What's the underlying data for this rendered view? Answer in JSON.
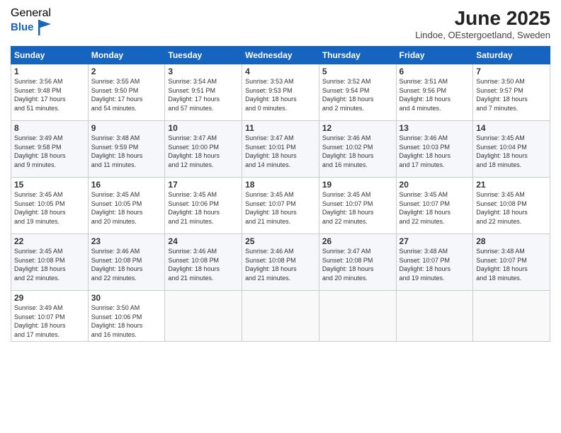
{
  "logo": {
    "general": "General",
    "blue": "Blue"
  },
  "title": "June 2025",
  "subtitle": "Lindoe, OEstergoetland, Sweden",
  "days_header": [
    "Sunday",
    "Monday",
    "Tuesday",
    "Wednesday",
    "Thursday",
    "Friday",
    "Saturday"
  ],
  "weeks": [
    [
      {
        "day": "1",
        "info": "Sunrise: 3:56 AM\nSunset: 9:48 PM\nDaylight: 17 hours\nand 51 minutes."
      },
      {
        "day": "2",
        "info": "Sunrise: 3:55 AM\nSunset: 9:50 PM\nDaylight: 17 hours\nand 54 minutes."
      },
      {
        "day": "3",
        "info": "Sunrise: 3:54 AM\nSunset: 9:51 PM\nDaylight: 17 hours\nand 57 minutes."
      },
      {
        "day": "4",
        "info": "Sunrise: 3:53 AM\nSunset: 9:53 PM\nDaylight: 18 hours\nand 0 minutes."
      },
      {
        "day": "5",
        "info": "Sunrise: 3:52 AM\nSunset: 9:54 PM\nDaylight: 18 hours\nand 2 minutes."
      },
      {
        "day": "6",
        "info": "Sunrise: 3:51 AM\nSunset: 9:56 PM\nDaylight: 18 hours\nand 4 minutes."
      },
      {
        "day": "7",
        "info": "Sunrise: 3:50 AM\nSunset: 9:57 PM\nDaylight: 18 hours\nand 7 minutes."
      }
    ],
    [
      {
        "day": "8",
        "info": "Sunrise: 3:49 AM\nSunset: 9:58 PM\nDaylight: 18 hours\nand 9 minutes."
      },
      {
        "day": "9",
        "info": "Sunrise: 3:48 AM\nSunset: 9:59 PM\nDaylight: 18 hours\nand 11 minutes."
      },
      {
        "day": "10",
        "info": "Sunrise: 3:47 AM\nSunset: 10:00 PM\nDaylight: 18 hours\nand 12 minutes."
      },
      {
        "day": "11",
        "info": "Sunrise: 3:47 AM\nSunset: 10:01 PM\nDaylight: 18 hours\nand 14 minutes."
      },
      {
        "day": "12",
        "info": "Sunrise: 3:46 AM\nSunset: 10:02 PM\nDaylight: 18 hours\nand 16 minutes."
      },
      {
        "day": "13",
        "info": "Sunrise: 3:46 AM\nSunset: 10:03 PM\nDaylight: 18 hours\nand 17 minutes."
      },
      {
        "day": "14",
        "info": "Sunrise: 3:45 AM\nSunset: 10:04 PM\nDaylight: 18 hours\nand 18 minutes."
      }
    ],
    [
      {
        "day": "15",
        "info": "Sunrise: 3:45 AM\nSunset: 10:05 PM\nDaylight: 18 hours\nand 19 minutes."
      },
      {
        "day": "16",
        "info": "Sunrise: 3:45 AM\nSunset: 10:05 PM\nDaylight: 18 hours\nand 20 minutes."
      },
      {
        "day": "17",
        "info": "Sunrise: 3:45 AM\nSunset: 10:06 PM\nDaylight: 18 hours\nand 21 minutes."
      },
      {
        "day": "18",
        "info": "Sunrise: 3:45 AM\nSunset: 10:07 PM\nDaylight: 18 hours\nand 21 minutes."
      },
      {
        "day": "19",
        "info": "Sunrise: 3:45 AM\nSunset: 10:07 PM\nDaylight: 18 hours\nand 22 minutes."
      },
      {
        "day": "20",
        "info": "Sunrise: 3:45 AM\nSunset: 10:07 PM\nDaylight: 18 hours\nand 22 minutes."
      },
      {
        "day": "21",
        "info": "Sunrise: 3:45 AM\nSunset: 10:08 PM\nDaylight: 18 hours\nand 22 minutes."
      }
    ],
    [
      {
        "day": "22",
        "info": "Sunrise: 3:45 AM\nSunset: 10:08 PM\nDaylight: 18 hours\nand 22 minutes."
      },
      {
        "day": "23",
        "info": "Sunrise: 3:46 AM\nSunset: 10:08 PM\nDaylight: 18 hours\nand 22 minutes."
      },
      {
        "day": "24",
        "info": "Sunrise: 3:46 AM\nSunset: 10:08 PM\nDaylight: 18 hours\nand 21 minutes."
      },
      {
        "day": "25",
        "info": "Sunrise: 3:46 AM\nSunset: 10:08 PM\nDaylight: 18 hours\nand 21 minutes."
      },
      {
        "day": "26",
        "info": "Sunrise: 3:47 AM\nSunset: 10:08 PM\nDaylight: 18 hours\nand 20 minutes."
      },
      {
        "day": "27",
        "info": "Sunrise: 3:48 AM\nSunset: 10:07 PM\nDaylight: 18 hours\nand 19 minutes."
      },
      {
        "day": "28",
        "info": "Sunrise: 3:48 AM\nSunset: 10:07 PM\nDaylight: 18 hours\nand 18 minutes."
      }
    ],
    [
      {
        "day": "29",
        "info": "Sunrise: 3:49 AM\nSunset: 10:07 PM\nDaylight: 18 hours\nand 17 minutes."
      },
      {
        "day": "30",
        "info": "Sunrise: 3:50 AM\nSunset: 10:06 PM\nDaylight: 18 hours\nand 16 minutes."
      },
      {
        "day": "",
        "info": ""
      },
      {
        "day": "",
        "info": ""
      },
      {
        "day": "",
        "info": ""
      },
      {
        "day": "",
        "info": ""
      },
      {
        "day": "",
        "info": ""
      }
    ]
  ]
}
